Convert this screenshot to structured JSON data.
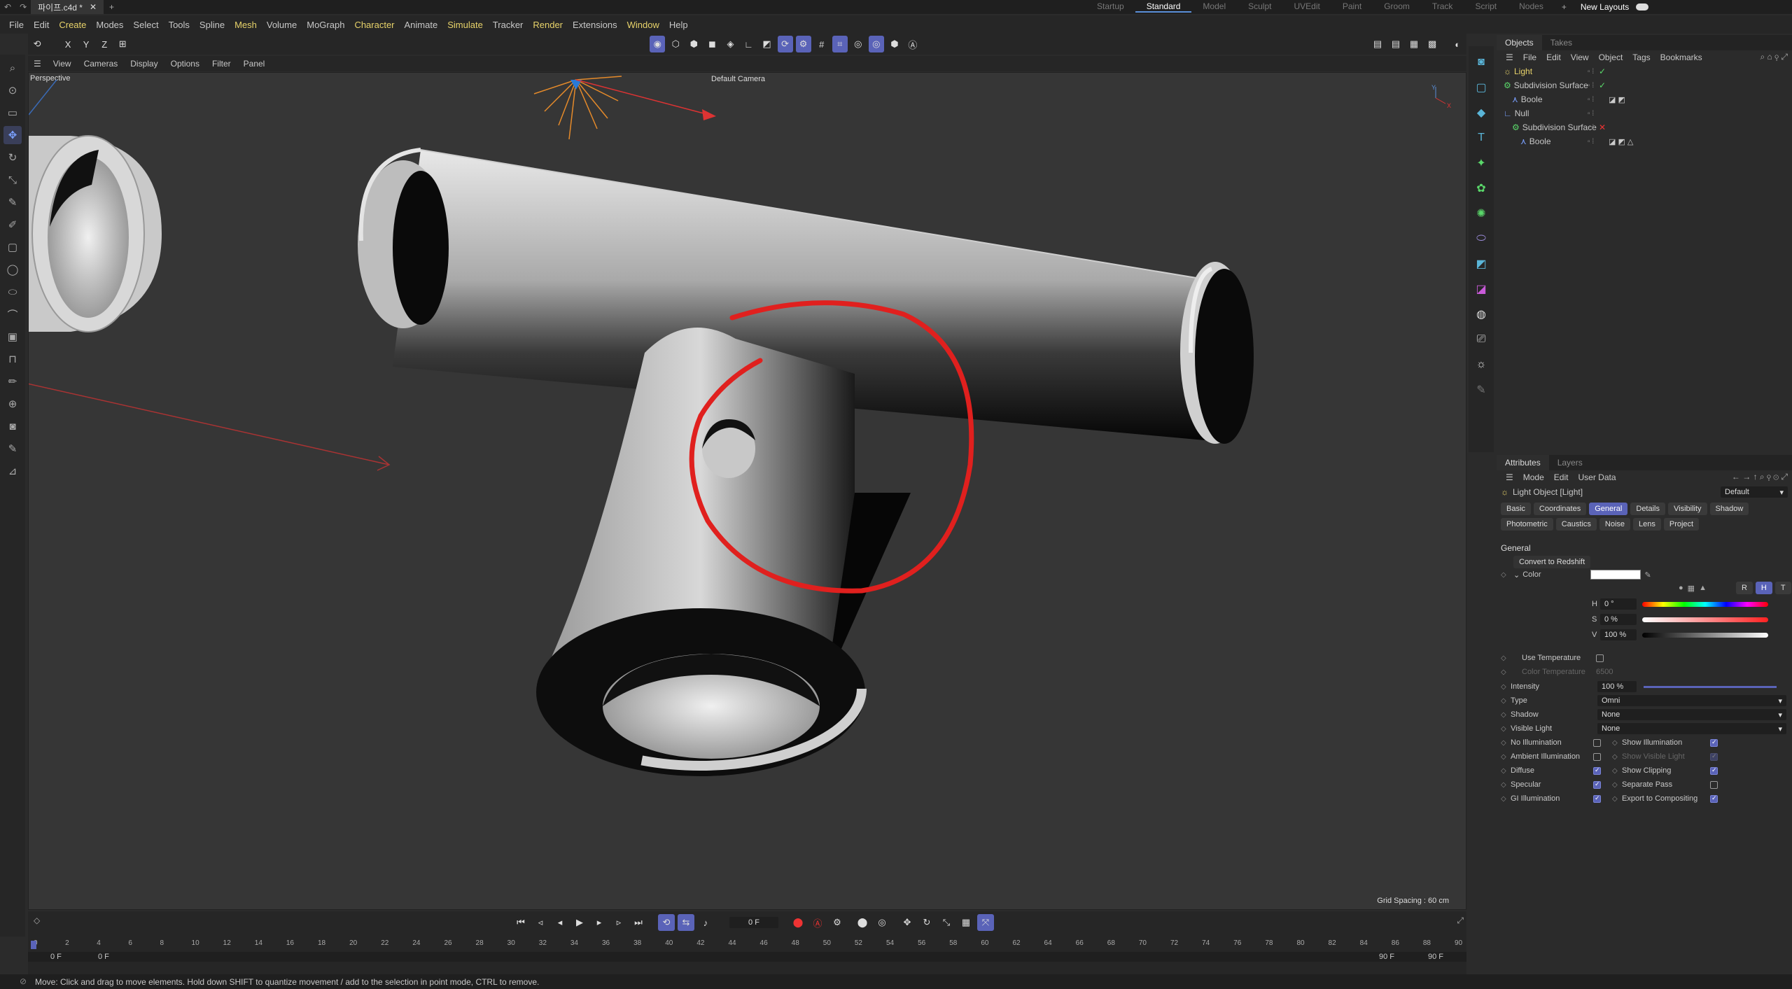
{
  "titlebar": {
    "file_tab": "파이프.c4d *",
    "new_layouts": "New Layouts",
    "layouts": [
      "Startup",
      "Standard",
      "Model",
      "Sculpt",
      "UVEdit",
      "Paint",
      "Groom",
      "Track",
      "Script",
      "Nodes"
    ],
    "active_layout": "Standard"
  },
  "menubar": [
    "File",
    "Edit",
    "Create",
    "Modes",
    "Select",
    "Tools",
    "Spline",
    "Mesh",
    "Volume",
    "MoGraph",
    "Character",
    "Animate",
    "Simulate",
    "Tracker",
    "Render",
    "Extensions",
    "Window",
    "Help"
  ],
  "view_menu": [
    "View",
    "Cameras",
    "Display",
    "Options",
    "Filter",
    "Panel"
  ],
  "viewport": {
    "label": "Perspective",
    "camera": "Default Camera",
    "grid_spacing": "Grid Spacing : 60 cm"
  },
  "objects_panel": {
    "tabs": [
      "Objects",
      "Takes"
    ],
    "menu": [
      "File",
      "Edit",
      "View",
      "Object",
      "Tags",
      "Bookmarks"
    ],
    "items": [
      {
        "name": "Light",
        "indent": 0,
        "status": "check"
      },
      {
        "name": "Subdivision Surface",
        "indent": 0,
        "status": "check"
      },
      {
        "name": "Boole",
        "indent": 1,
        "status": ""
      },
      {
        "name": "Null",
        "indent": 0,
        "status": ""
      },
      {
        "name": "Subdivision Surface",
        "indent": 1,
        "status": "cross"
      },
      {
        "name": "Boole",
        "indent": 2,
        "status": ""
      }
    ]
  },
  "attributes": {
    "tabs": [
      "Attributes",
      "Layers"
    ],
    "menu": [
      "Mode",
      "Edit",
      "User Data"
    ],
    "object_title": "Light Object [Light]",
    "preset": "Default",
    "subtabs_row1": [
      "Basic",
      "Coordinates",
      "General",
      "Details",
      "Visibility",
      "Shadow"
    ],
    "subtabs_row2": [
      "Photometric",
      "Caustics",
      "Noise",
      "Lens",
      "Project"
    ],
    "active_subtab": "General",
    "section": "General",
    "convert_button": "Convert to Redshift",
    "color_label": "Color",
    "color_modes": [
      "R",
      "H",
      "T"
    ],
    "h_label": "H",
    "h_value": "0 °",
    "s_label": "S",
    "s_value": "0 %",
    "v_label": "V",
    "v_value": "100 %",
    "use_temperature": "Use Temperature",
    "color_temperature": "Color Temperature",
    "color_temperature_value": "6500",
    "intensity_label": "Intensity",
    "intensity_value": "100 %",
    "type_label": "Type",
    "type_value": "Omni",
    "shadow_label": "Shadow",
    "shadow_value": "None",
    "visible_light_label": "Visible Light",
    "visible_light_value": "None",
    "left_checks": [
      {
        "label": "No Illumination",
        "checked": false
      },
      {
        "label": "Ambient Illumination",
        "checked": false
      },
      {
        "label": "Diffuse",
        "checked": true
      },
      {
        "label": "Specular",
        "checked": true
      },
      {
        "label": "GI Illumination",
        "checked": true
      }
    ],
    "right_checks": [
      {
        "label": "Show Illumination",
        "checked": true
      },
      {
        "label": "Show Visible Light",
        "checked": true
      },
      {
        "label": "Show Clipping",
        "checked": true
      },
      {
        "label": "Separate Pass",
        "checked": false
      },
      {
        "label": "Export to Compositing",
        "checked": true
      }
    ]
  },
  "timeline": {
    "current_frame": "0 F",
    "start": "0 F",
    "start2": "0 F",
    "end": "90 F",
    "end2": "90 F",
    "ticks": [
      "0",
      "2",
      "4",
      "6",
      "8",
      "10",
      "12",
      "14",
      "16",
      "18",
      "20",
      "22",
      "24",
      "26",
      "28",
      "30",
      "32",
      "34",
      "36",
      "38",
      "40",
      "42",
      "44",
      "46",
      "48",
      "50",
      "52",
      "54",
      "56",
      "58",
      "60",
      "62",
      "64",
      "66",
      "68",
      "70",
      "72",
      "74",
      "76",
      "78",
      "80",
      "82",
      "84",
      "86",
      "88",
      "90"
    ]
  },
  "status": "Move: Click and drag to move elements. Hold down SHIFT to quantize movement / add to the selection in point mode, CTRL to remove."
}
